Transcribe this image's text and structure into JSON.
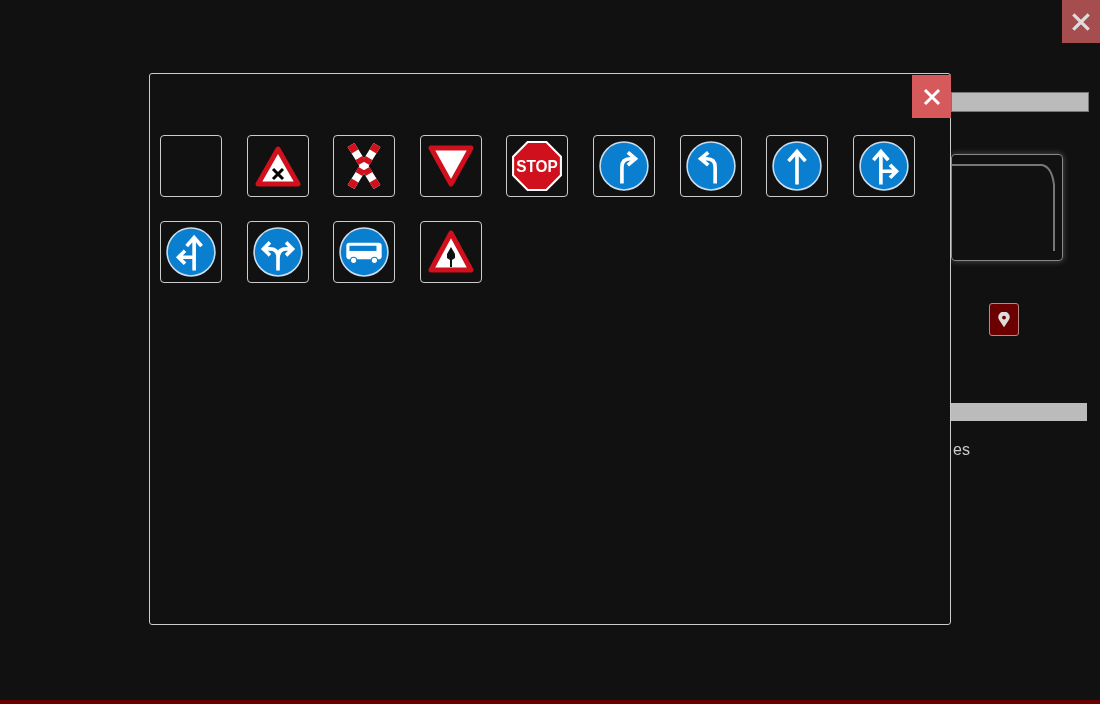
{
  "page": {
    "partial_label": "es"
  },
  "sign_picker": {
    "signs": [
      {
        "kind": "blank"
      },
      {
        "kind": "crossroads"
      },
      {
        "kind": "st-andrews-cross"
      },
      {
        "kind": "yield"
      },
      {
        "kind": "stop",
        "label": "STOP"
      },
      {
        "kind": "turn-right"
      },
      {
        "kind": "turn-left"
      },
      {
        "kind": "straight"
      },
      {
        "kind": "straight-or-right"
      },
      {
        "kind": "straight-or-left"
      },
      {
        "kind": "left-or-right"
      },
      {
        "kind": "bus"
      },
      {
        "kind": "priority-road"
      }
    ]
  }
}
